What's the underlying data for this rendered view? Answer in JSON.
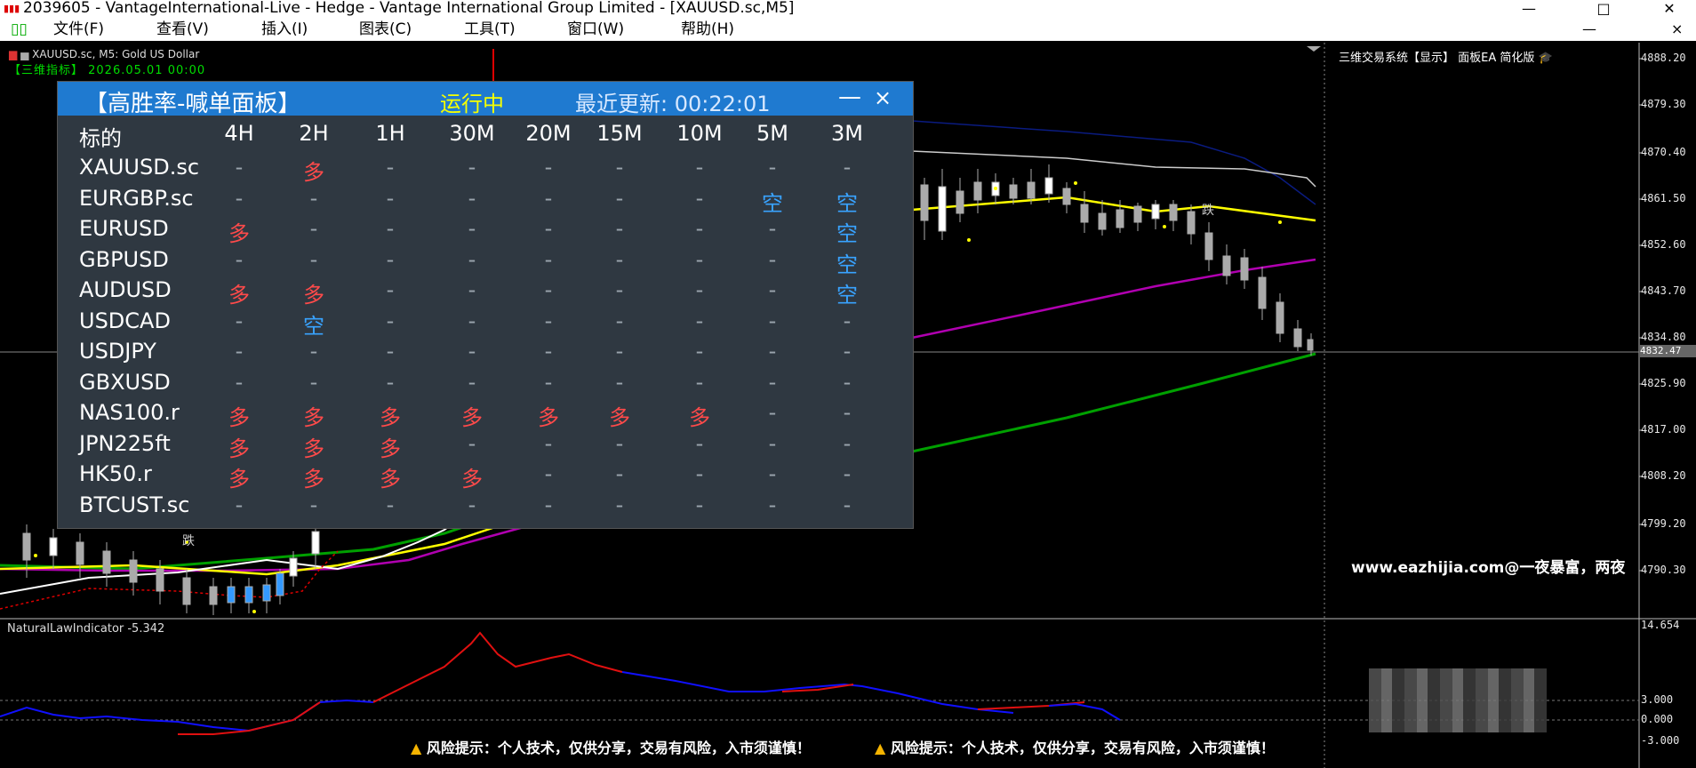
{
  "window": {
    "title": "2039605 - VantageInternational-Live - Hedge - Vantage International Group Limited - [XAUUSD.sc,M5]",
    "min": "—",
    "max": "□",
    "close": "✕"
  },
  "menu": {
    "items": [
      "文件(F)",
      "查看(V)",
      "插入(I)",
      "图表(C)",
      "工具(T)",
      "窗口(W)",
      "帮助(H)"
    ],
    "doc_min": "—",
    "doc_close": "×"
  },
  "chart": {
    "symbol_header": "XAUUSD.sc, M5:  Gold US Dollar",
    "indicator_label": "【三维指标】  2026.05.01 00:00",
    "top_right": "三维交易系统【显示】 面板EA 简化版",
    "candle_label_main": "跌",
    "candle_label_right": "跌",
    "price_axis": [
      "4888.20",
      "4879.30",
      "4870.40",
      "4861.50",
      "4852.60",
      "4843.70",
      "4834.80",
      "4825.90",
      "4817.00",
      "4808.20",
      "4799.20",
      "4790.30"
    ],
    "current_price": "4832.47",
    "sub_axis": [
      "14.654",
      "3.000",
      "0.000",
      "-3.000"
    ],
    "sub_indicator": "NaturalLawIndicator -5.342",
    "watermark": "www.eazhijia.com@一夜暴富，两夜",
    "risk_text": "风险提示：个人技术，仅供分享，交易有风险，入市须谨慎！",
    "colors": {
      "up": "#ffffff",
      "ma_yellow": "#ffff00",
      "ma_magenta": "#b000b0",
      "ma_green": "#00a000",
      "ind_red": "#e01010",
      "ind_blue": "#1010ff"
    }
  },
  "panel": {
    "title": "【高胜率-喊单面板】",
    "status": "运行中",
    "update": "最近更新: 00:22:01",
    "min": "—",
    "close": "×",
    "columns": [
      "标的",
      "4H",
      "2H",
      "1H",
      "30M",
      "20M",
      "15M",
      "10M",
      "5M",
      "3M"
    ],
    "rows": [
      {
        "symbol": "XAUUSD.sc",
        "signals": [
          "-",
          "多",
          "-",
          "-",
          "-",
          "-",
          "-",
          "-",
          "-"
        ]
      },
      {
        "symbol": "EURGBP.sc",
        "signals": [
          "-",
          "-",
          "-",
          "-",
          "-",
          "-",
          "-",
          "空",
          "空"
        ]
      },
      {
        "symbol": "EURUSD",
        "signals": [
          "多",
          "-",
          "-",
          "-",
          "-",
          "-",
          "-",
          "-",
          "空"
        ]
      },
      {
        "symbol": "GBPUSD",
        "signals": [
          "-",
          "-",
          "-",
          "-",
          "-",
          "-",
          "-",
          "-",
          "空"
        ]
      },
      {
        "symbol": "AUDUSD",
        "signals": [
          "多",
          "多",
          "-",
          "-",
          "-",
          "-",
          "-",
          "-",
          "空"
        ]
      },
      {
        "symbol": "USDCAD",
        "signals": [
          "-",
          "空",
          "-",
          "-",
          "-",
          "-",
          "-",
          "-",
          "-"
        ]
      },
      {
        "symbol": "USDJPY",
        "signals": [
          "-",
          "-",
          "-",
          "-",
          "-",
          "-",
          "-",
          "-",
          "-"
        ]
      },
      {
        "symbol": "GBXUSD",
        "signals": [
          "-",
          "-",
          "-",
          "-",
          "-",
          "-",
          "-",
          "-",
          "-"
        ]
      },
      {
        "symbol": "NAS100.r",
        "signals": [
          "多",
          "多",
          "多",
          "多",
          "多",
          "多",
          "多",
          "-",
          "-"
        ]
      },
      {
        "symbol": "JPN225ft",
        "signals": [
          "多",
          "多",
          "多",
          "-",
          "-",
          "-",
          "-",
          "-",
          "-"
        ]
      },
      {
        "symbol": "HK50.r",
        "signals": [
          "多",
          "多",
          "多",
          "多",
          "-",
          "-",
          "-",
          "-",
          "-"
        ]
      },
      {
        "symbol": "BTCUST.sc",
        "signals": [
          "-",
          "-",
          "-",
          "-",
          "-",
          "-",
          "-",
          "-",
          "-"
        ]
      }
    ]
  }
}
